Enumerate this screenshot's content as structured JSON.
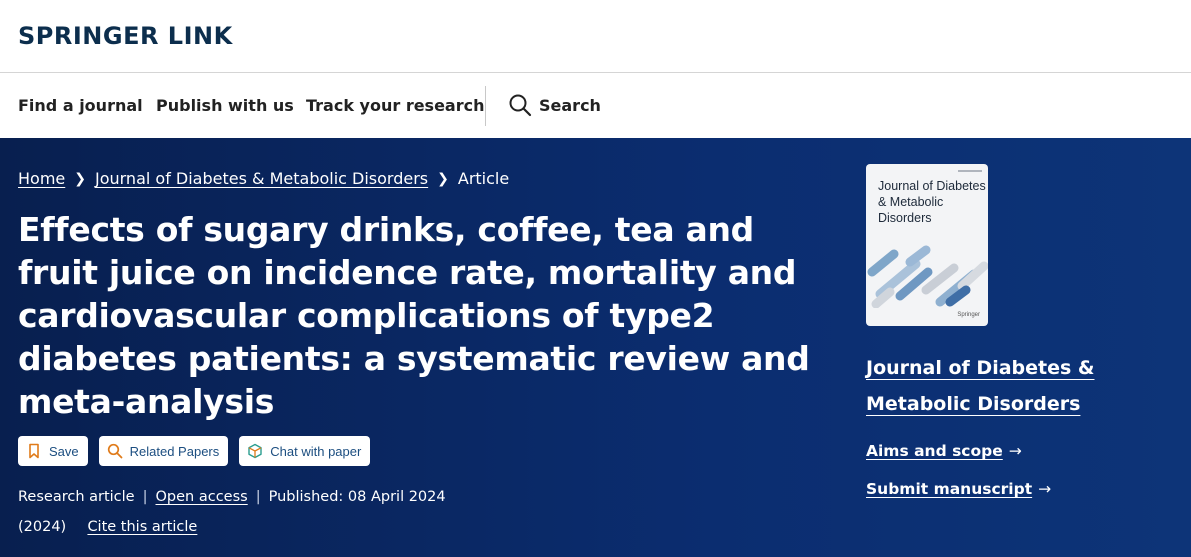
{
  "header": {
    "logo": "SPRINGER LINK"
  },
  "nav": {
    "find_journal": "Find a journal",
    "publish": "Publish with us",
    "track": "Track your research",
    "search": "Search"
  },
  "breadcrumb": {
    "home": "Home",
    "journal": "Journal of Diabetes & Metabolic Disorders",
    "current": "Article"
  },
  "article": {
    "title": "Effects of sugary drinks, coffee, tea and fruit juice on incidence rate, mortality and cardiovascular complications of type2 diabetes patients: a systematic review and meta-analysis",
    "buttons": {
      "save": "Save",
      "related": "Related Papers",
      "chat": "Chat with paper"
    },
    "type": "Research article",
    "access": "Open access",
    "published": "Published: 08 April 2024",
    "year": "(2024)",
    "cite": "Cite this article"
  },
  "sidebar": {
    "cover_title": "Journal of Diabetes & Metabolic Disorders",
    "cover_brand": "Springer",
    "journal_name": "Journal of Diabetes & Metabolic Disorders",
    "aims": "Aims and scope",
    "submit": "Submit manuscript"
  },
  "icons": {
    "search": "search-icon",
    "save": "bookmark-icon",
    "related": "search-icon",
    "chat": "chat-cube-icon",
    "arrow": "arrow-right-icon"
  },
  "colors": {
    "brand": "#0c2e4d",
    "hero_bg": "#0b2d70",
    "pill_text": "#1c4e80",
    "save_icon": "#e07b1a",
    "related_icon": "#e07b1a",
    "chat_icon": "#2a9d8f"
  }
}
